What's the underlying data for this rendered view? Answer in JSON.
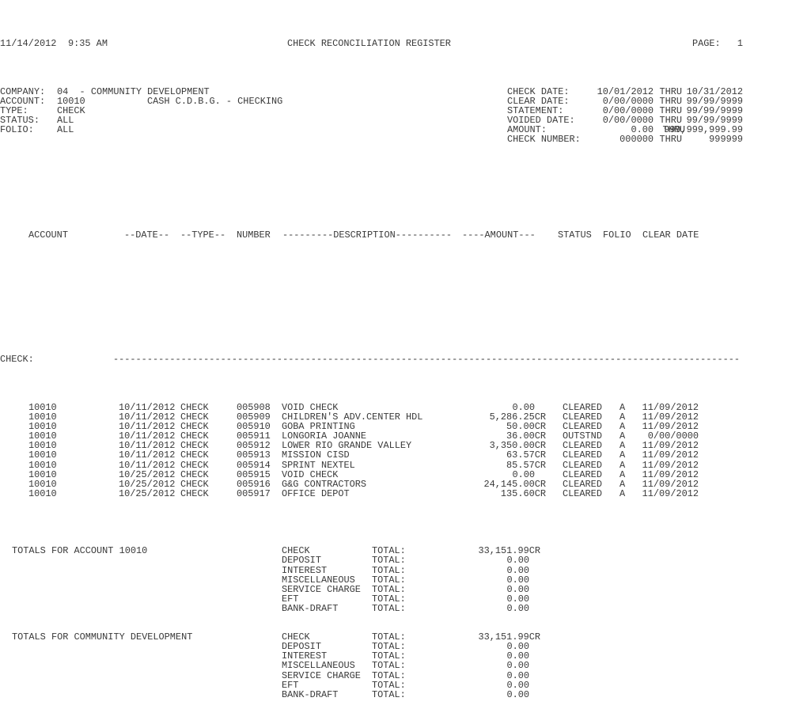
{
  "report": {
    "run_date": "11/14/2012",
    "run_time": "9:35 AM",
    "title": "CHECK RECONCILIATION REGISTER",
    "page_label": "PAGE:",
    "page_number": "1"
  },
  "filters_left": [
    {
      "label": "COMPANY:",
      "value": "04  - COMMUNITY DEVELOPMENT",
      "extra": ""
    },
    {
      "label": "ACCOUNT:",
      "value": "10010",
      "extra": "CASH C.D.B.G. - CHECKING"
    },
    {
      "label": "TYPE:",
      "value": "CHECK",
      "extra": ""
    },
    {
      "label": "STATUS:",
      "value": "ALL",
      "extra": ""
    },
    {
      "label": "FOLIO:",
      "value": "ALL",
      "extra": ""
    }
  ],
  "filters_right": [
    {
      "label": "CHECK DATE:",
      "from": "10/01/2012",
      "thru": "THRU",
      "to": "10/31/2012"
    },
    {
      "label": "CLEAR DATE:",
      "from": "0/00/0000",
      "thru": "THRU",
      "to": "99/99/9999"
    },
    {
      "label": "STATEMENT:",
      "from": "0/00/0000",
      "thru": "THRU",
      "to": "99/99/9999"
    },
    {
      "label": "VOIDED DATE:",
      "from": "0/00/0000",
      "thru": "THRU",
      "to": "99/99/9999"
    },
    {
      "label": "AMOUNT:",
      "from": "0.00",
      "thru": "THRU",
      "to": "999,999,999.99"
    },
    {
      "label": "CHECK NUMBER:",
      "from": "000000",
      "thru": "THRU",
      "to": "999999"
    }
  ],
  "columns": {
    "account": "ACCOUNT",
    "date": "--DATE--",
    "type": "--TYPE--",
    "number": "NUMBER",
    "description": "---------DESCRIPTION----------",
    "amount": "----AMOUNT---",
    "status": "STATUS",
    "folio": "FOLIO",
    "clear_date": "CLEAR DATE"
  },
  "section_label": "CHECK:",
  "rows": [
    {
      "account": "10010",
      "date": "10/11/2012",
      "type": "CHECK",
      "number": "005908",
      "description": "VOID CHECK",
      "amount": "0.00",
      "status": "CLEARED",
      "folio": "A",
      "clear_date": "11/09/2012"
    },
    {
      "account": "10010",
      "date": "10/11/2012",
      "type": "CHECK",
      "number": "005909",
      "description": "CHILDREN'S ADV.CENTER HDL",
      "amount": "5,286.25CR",
      "status": "CLEARED",
      "folio": "A",
      "clear_date": "11/09/2012"
    },
    {
      "account": "10010",
      "date": "10/11/2012",
      "type": "CHECK",
      "number": "005910",
      "description": "GOBA PRINTING",
      "amount": "50.00CR",
      "status": "CLEARED",
      "folio": "A",
      "clear_date": "11/09/2012"
    },
    {
      "account": "10010",
      "date": "10/11/2012",
      "type": "CHECK",
      "number": "005911",
      "description": "LONGORIA JOANNE",
      "amount": "36.00CR",
      "status": "OUTSTND",
      "folio": "A",
      "clear_date": "0/00/0000"
    },
    {
      "account": "10010",
      "date": "10/11/2012",
      "type": "CHECK",
      "number": "005912",
      "description": "LOWER RIO GRANDE VALLEY",
      "amount": "3,350.00CR",
      "status": "CLEARED",
      "folio": "A",
      "clear_date": "11/09/2012"
    },
    {
      "account": "10010",
      "date": "10/11/2012",
      "type": "CHECK",
      "number": "005913",
      "description": "MISSION CISD",
      "amount": "63.57CR",
      "status": "CLEARED",
      "folio": "A",
      "clear_date": "11/09/2012"
    },
    {
      "account": "10010",
      "date": "10/11/2012",
      "type": "CHECK",
      "number": "005914",
      "description": "SPRINT NEXTEL",
      "amount": "85.57CR",
      "status": "CLEARED",
      "folio": "A",
      "clear_date": "11/09/2012"
    },
    {
      "account": "10010",
      "date": "10/25/2012",
      "type": "CHECK",
      "number": "005915",
      "description": "VOID CHECK",
      "amount": "0.00",
      "status": "CLEARED",
      "folio": "A",
      "clear_date": "11/09/2012"
    },
    {
      "account": "10010",
      "date": "10/25/2012",
      "type": "CHECK",
      "number": "005916",
      "description": "G&G CONTRACTORS",
      "amount": "24,145.00CR",
      "status": "CLEARED",
      "folio": "A",
      "clear_date": "11/09/2012"
    },
    {
      "account": "10010",
      "date": "10/25/2012",
      "type": "CHECK",
      "number": "005917",
      "description": "OFFICE DEPOT",
      "amount": "135.60CR",
      "status": "CLEARED",
      "folio": "A",
      "clear_date": "11/09/2012"
    }
  ],
  "totals": [
    {
      "heading": "TOTALS FOR ACCOUNT 10010",
      "lines": [
        {
          "category": "CHECK",
          "label": "TOTAL:",
          "amount": "33,151.99CR"
        },
        {
          "category": "DEPOSIT",
          "label": "TOTAL:",
          "amount": "0.00"
        },
        {
          "category": "INTEREST",
          "label": "TOTAL:",
          "amount": "0.00"
        },
        {
          "category": "MISCELLANEOUS",
          "label": "TOTAL:",
          "amount": "0.00"
        },
        {
          "category": "SERVICE CHARGE",
          "label": "TOTAL:",
          "amount": "0.00"
        },
        {
          "category": "EFT",
          "label": "TOTAL:",
          "amount": "0.00"
        },
        {
          "category": "BANK-DRAFT",
          "label": "TOTAL:",
          "amount": "0.00"
        }
      ]
    },
    {
      "heading": "TOTALS FOR COMMUNITY DEVELOPMENT",
      "lines": [
        {
          "category": "CHECK",
          "label": "TOTAL:",
          "amount": "33,151.99CR"
        },
        {
          "category": "DEPOSIT",
          "label": "TOTAL:",
          "amount": "0.00"
        },
        {
          "category": "INTEREST",
          "label": "TOTAL:",
          "amount": "0.00"
        },
        {
          "category": "MISCELLANEOUS",
          "label": "TOTAL:",
          "amount": "0.00"
        },
        {
          "category": "SERVICE CHARGE",
          "label": "TOTAL:",
          "amount": "0.00"
        },
        {
          "category": "EFT",
          "label": "TOTAL:",
          "amount": "0.00"
        },
        {
          "category": "BANK-DRAFT",
          "label": "TOTAL:",
          "amount": "0.00"
        }
      ]
    }
  ]
}
